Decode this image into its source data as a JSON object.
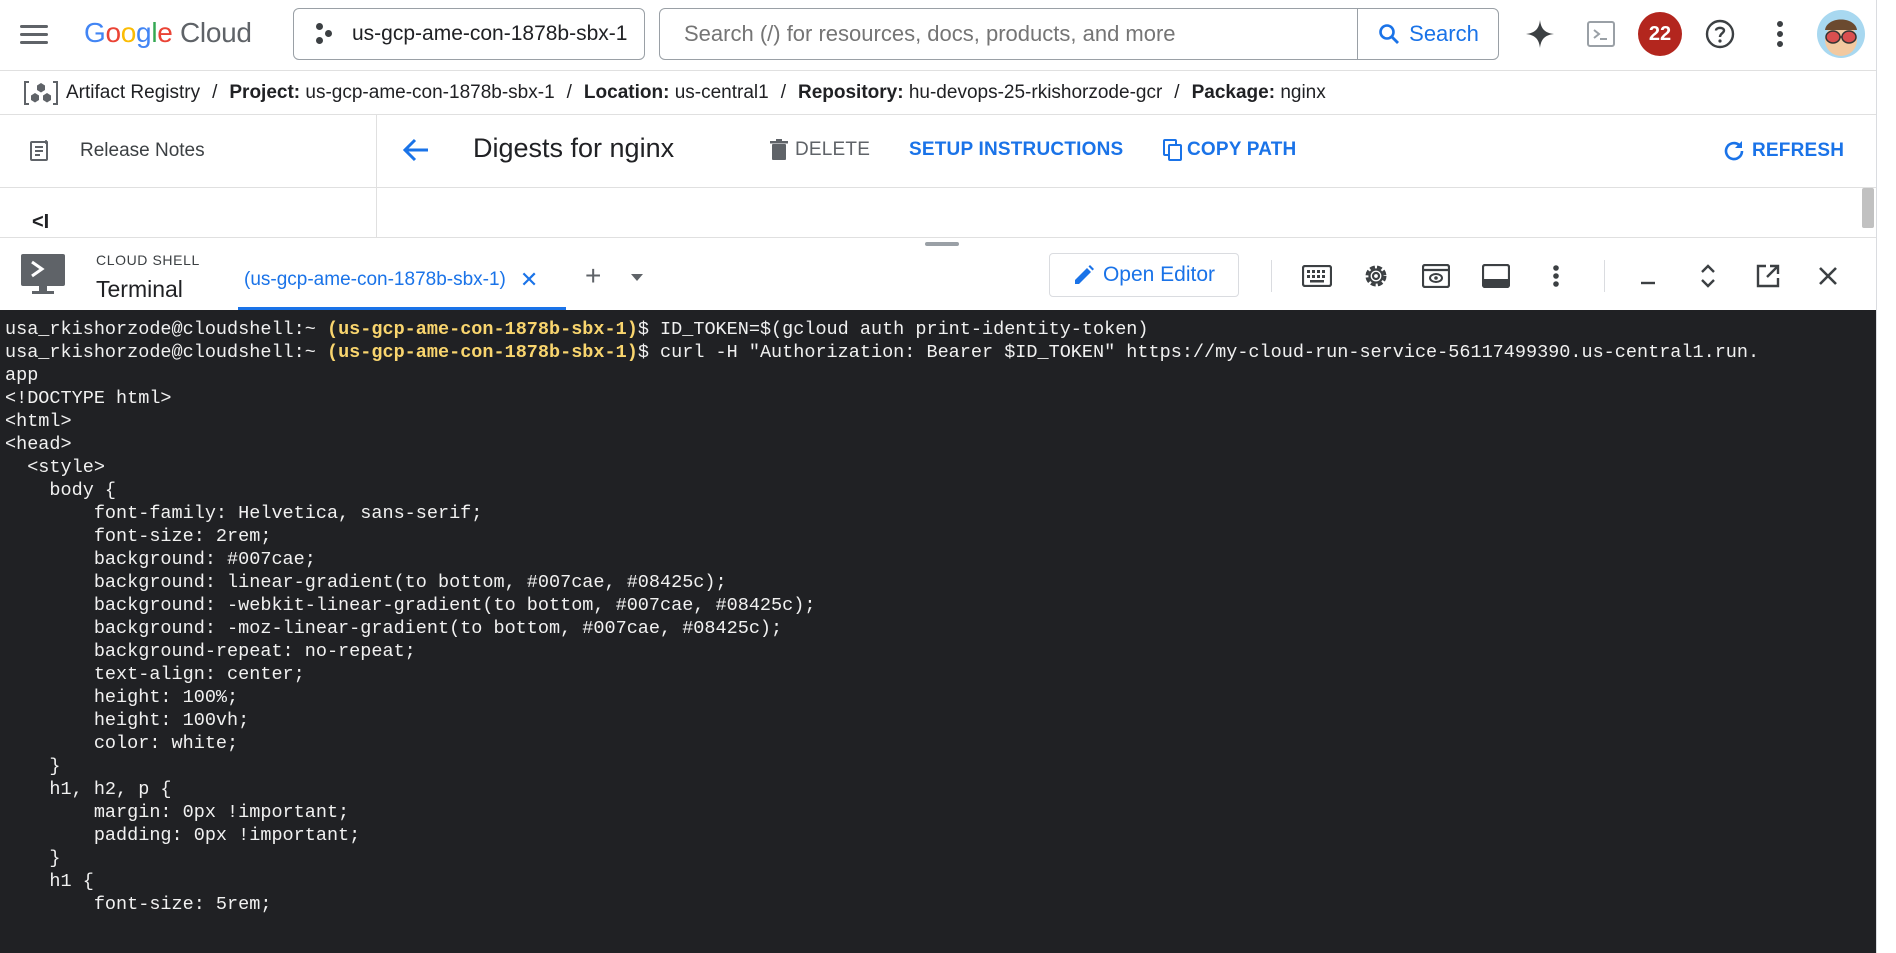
{
  "header": {
    "logo_google": "Google",
    "logo_cloud": "Cloud",
    "project": "us-gcp-ame-con-1878b-sbx-1",
    "search_placeholder": "Search (/) for resources, docs, products, and more",
    "search_button": "Search",
    "notifications_count": "22"
  },
  "breadcrumb": {
    "service": "Artifact Registry",
    "project_label": "Project:",
    "project_value": "us-gcp-ame-con-1878b-sbx-1",
    "location_label": "Location:",
    "location_value": "us-central1",
    "repository_label": "Repository:",
    "repository_value": "hu-devops-25-rkishorzode-gcr",
    "package_label": "Package:",
    "package_value": "nginx",
    "separator": "/"
  },
  "sidebar": {
    "release_notes": "Release Notes",
    "collapse_glyph": "<I"
  },
  "main": {
    "title": "Digests for nginx",
    "delete_label": "DELETE",
    "setup_label": "SETUP INSTRUCTIONS",
    "copy_path_label": "COPY PATH",
    "refresh_label": "REFRESH"
  },
  "shell": {
    "section_label": "CLOUD SHELL",
    "terminal_label": "Terminal",
    "tab_label": "(us-gcp-ame-con-1878b-sbx-1)",
    "tab_close": "✕",
    "add_tab": "+",
    "open_editor": "Open Editor"
  },
  "terminal": {
    "user_prompt": "usa_rkishorzode@cloudshell:~",
    "project_prompt": "(us-gcp-ame-con-1878b-sbx-1)",
    "cmd1": "$ ID_TOKEN=$(gcloud auth print-identity-token)",
    "cmd2": "$ curl -H \"Authorization: Bearer $ID_TOKEN\" https://my-cloud-run-service-56117499390.us-central1.run.",
    "output": "app\n<!DOCTYPE html>\n<html>\n<head>\n  <style>\n    body {\n        font-family: Helvetica, sans-serif;\n        font-size: 2rem;\n        background: #007cae;\n        background: linear-gradient(to bottom, #007cae, #08425c);\n        background: -webkit-linear-gradient(to bottom, #007cae, #08425c);\n        background: -moz-linear-gradient(to bottom, #007cae, #08425c);\n        background-repeat: no-repeat;\n        text-align: center;\n        height: 100%;\n        height: 100vh;\n        color: white;\n    }\n    h1, h2, p {\n        margin: 0px !important;\n        padding: 0px !important;\n    }\n    h1 {\n        font-size: 5rem;"
  },
  "colors": {
    "accent": "#1a73e8",
    "terminal_bg": "#202124",
    "prompt_project": "#f9d56e",
    "badge": "#b3261e"
  },
  "icons": [
    "menu-icon",
    "project-dots-icon",
    "search-icon",
    "gemini-icon",
    "cloud-shell-icon",
    "help-icon",
    "more-vert-icon",
    "artifact-registry-icon",
    "release-notes-icon",
    "back-arrow-icon",
    "delete-icon",
    "copy-icon",
    "refresh-icon",
    "terminal-icon",
    "pencil-icon",
    "keyboard-icon",
    "settings-icon",
    "web-preview-icon",
    "layout-icon",
    "minimize-icon",
    "restore-icon",
    "open-new-window-icon",
    "close-icon"
  ]
}
